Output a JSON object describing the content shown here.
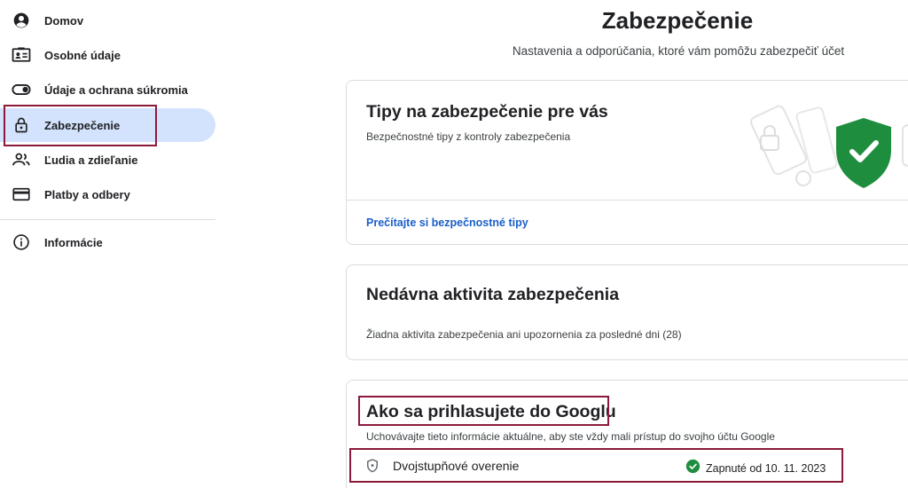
{
  "sidebar": {
    "items": [
      {
        "label": "Domov",
        "icon": "account-circle-icon"
      },
      {
        "label": "Osobné údaje",
        "icon": "id-card-icon"
      },
      {
        "label": "Údaje a ochrana súkromia",
        "icon": "toggle-icon"
      },
      {
        "label": "Zabezpečenie",
        "icon": "lock-icon",
        "active": true
      },
      {
        "label": "Ľudia a zdieľanie",
        "icon": "people-icon"
      },
      {
        "label": "Platby a odbery",
        "icon": "credit-card-icon"
      },
      {
        "label": "Informácie",
        "icon": "info-icon"
      }
    ]
  },
  "header": {
    "title": "Zabezpečenie",
    "subtitle": "Nastavenia a odporúčania, ktoré vám pomôžu zabezpečiť účet"
  },
  "cards": {
    "tips": {
      "title": "Tipy na zabezpečenie pre vás",
      "description": "Bezpečnostné tipy z kontroly zabezpečenia",
      "link": "Prečítajte si bezpečnostné tipy"
    },
    "activity": {
      "title": "Nedávna aktivita zabezpečenia",
      "description": "Žiadna aktivita zabezpečenia ani upozornenia za posledné dni (28)"
    },
    "signin": {
      "title": "Ako sa prihlasujete do Googlu",
      "description": "Uchovávajte tieto informácie aktuálne, aby ste vždy mali prístup do svojho účtu Google",
      "rows": [
        {
          "label": "Dvojstupňové overenie",
          "status": "Zapnuté od 10. 11. 2023",
          "icon": "shield-icon",
          "status_icon": "check-circle-icon"
        }
      ]
    }
  },
  "colors": {
    "accent": "#1a5fc9",
    "active_bg": "#d3e3fd",
    "highlight_border": "#8b1a3a",
    "shield_green": "#1e8e3e",
    "status_green": "#1e8e3e"
  }
}
